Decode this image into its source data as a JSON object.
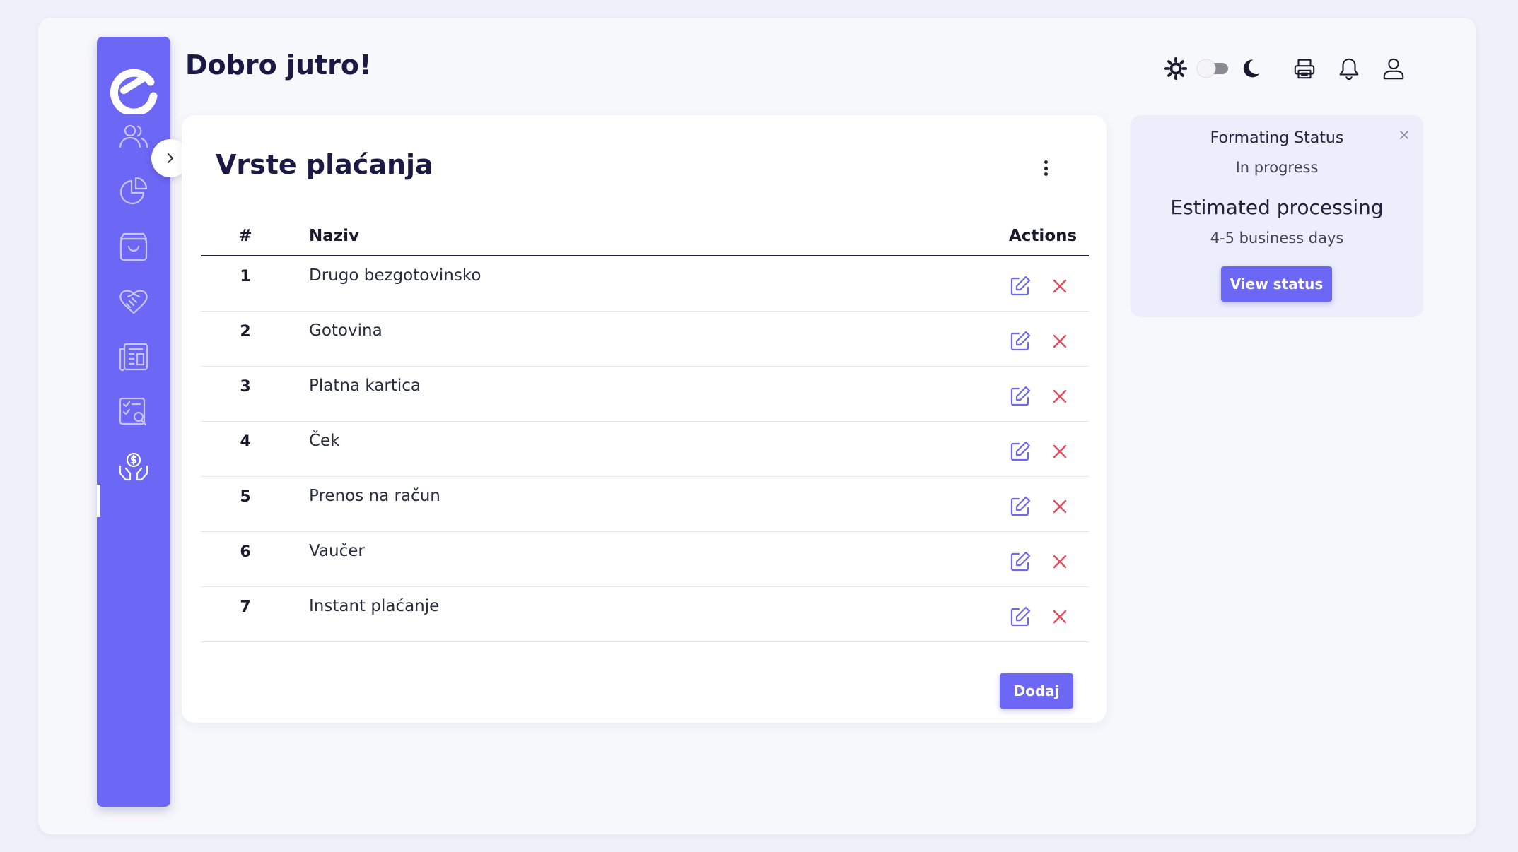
{
  "header": {
    "greeting": "Dobro jutro!"
  },
  "sidebar": {
    "items": [
      {
        "icon": "users-icon"
      },
      {
        "icon": "pie-chart-icon"
      },
      {
        "icon": "shopping-bag-icon"
      },
      {
        "icon": "handshake-icon"
      },
      {
        "icon": "newspaper-icon"
      },
      {
        "icon": "checklist-search-icon"
      },
      {
        "icon": "hands-money-icon",
        "active": true
      }
    ]
  },
  "topbar": {
    "icons": [
      "sun-icon",
      "theme-toggle",
      "moon-icon",
      "printer-icon",
      "bell-icon",
      "user-icon"
    ]
  },
  "card": {
    "title": "Vrste plaćanja",
    "columns": {
      "num": "#",
      "name": "Naziv",
      "actions": "Actions"
    },
    "rows": [
      {
        "num": "1",
        "name": "Drugo bezgotovinsko"
      },
      {
        "num": "2",
        "name": "Gotovina"
      },
      {
        "num": "3",
        "name": "Platna kartica"
      },
      {
        "num": "4",
        "name": "Ček"
      },
      {
        "num": "5",
        "name": "Prenos na račun"
      },
      {
        "num": "6",
        "name": "Vaučer"
      },
      {
        "num": "7",
        "name": "Instant plaćanje"
      }
    ],
    "add_label": "Dodaj"
  },
  "status": {
    "title": "Formating Status",
    "subtitle": "In progress",
    "estimate": "Estimated processing",
    "days": "4-5 business days",
    "button": "View status"
  },
  "colors": {
    "accent": "#6c67f5",
    "delete": "#e04b5a",
    "background": "#eef0fa"
  }
}
